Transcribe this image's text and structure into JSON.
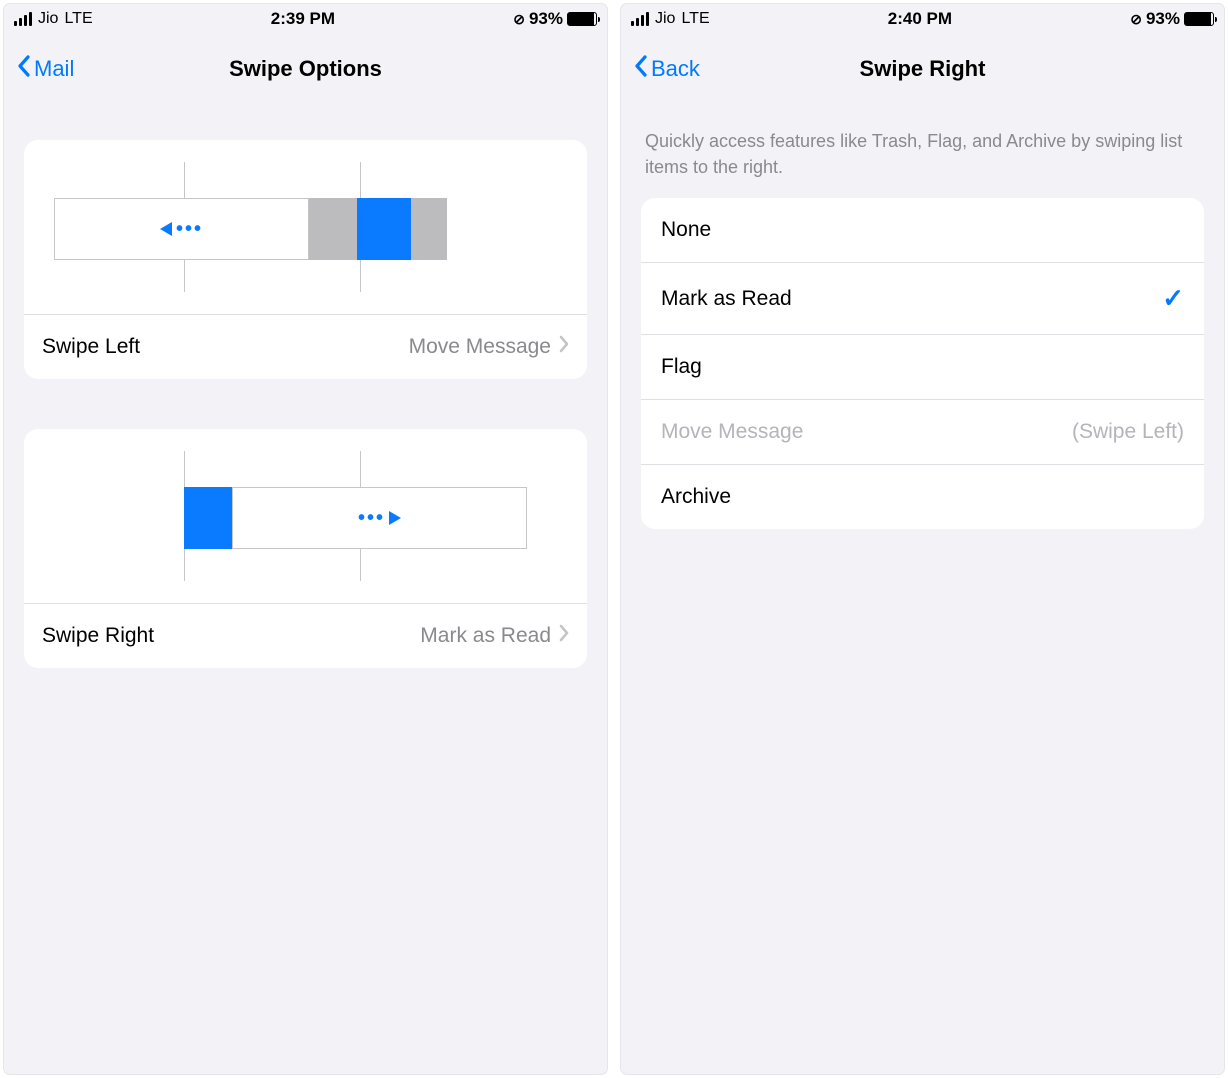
{
  "left": {
    "status": {
      "carrier": "Jio",
      "network": "LTE",
      "time": "2:39 PM",
      "battery": "93%"
    },
    "nav": {
      "back": "Mail",
      "title": "Swipe Options"
    },
    "swipeLeft": {
      "label": "Swipe Left",
      "value": "Move Message"
    },
    "swipeRight": {
      "label": "Swipe Right",
      "value": "Mark as Read"
    }
  },
  "right": {
    "status": {
      "carrier": "Jio",
      "network": "LTE",
      "time": "2:40 PM",
      "battery": "93%"
    },
    "nav": {
      "back": "Back",
      "title": "Swipe Right"
    },
    "descr": "Quickly access features like Trash, Flag, and Archive by swiping list items to the right.",
    "options": {
      "none": "None",
      "markRead": "Mark as Read",
      "flag": "Flag",
      "move": "Move Message",
      "moveAside": "(Swipe Left)",
      "archive": "Archive"
    }
  }
}
